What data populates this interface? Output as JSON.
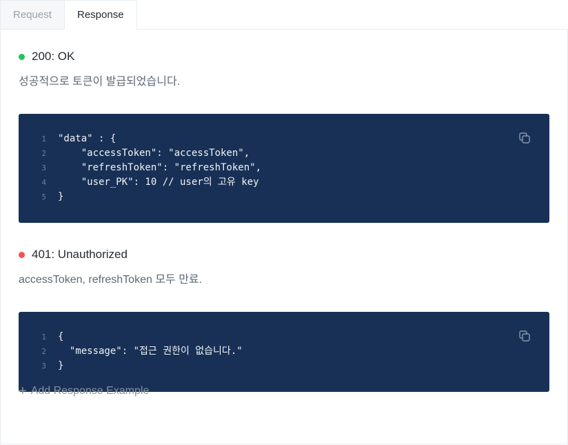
{
  "tabs": [
    {
      "label": "Request",
      "active": false
    },
    {
      "label": "Response",
      "active": true
    }
  ],
  "responses": [
    {
      "status": "200: OK",
      "status_color": "#21c45d",
      "description": "성공적으로 토큰이 발급되었습니다.",
      "code_lines": [
        {
          "num": "1",
          "text": "\"data\" : {"
        },
        {
          "num": "2",
          "text": "    \"accessToken\": \"accessToken\","
        },
        {
          "num": "3",
          "text": "    \"refreshToken\": \"refreshToken\","
        },
        {
          "num": "4",
          "text": "    \"user_PK\": 10 // user의 고유 key"
        },
        {
          "num": "5",
          "text": "}"
        }
      ]
    },
    {
      "status": "401: Unauthorized",
      "status_color": "#f05252",
      "description": "accessToken, refreshToken 모두 만료.",
      "code_lines": [
        {
          "num": "1",
          "text": "{"
        },
        {
          "num": "2",
          "text": "  \"message\": \"접근 권한이 없습니다.\""
        },
        {
          "num": "3",
          "text": "}"
        }
      ]
    }
  ],
  "add_label": "Add Response Example",
  "icons": {
    "copy": "copy-icon",
    "add": "plus-icon"
  },
  "colors": {
    "code_bg": "#183055",
    "ok": "#21c45d",
    "error": "#f05252"
  }
}
